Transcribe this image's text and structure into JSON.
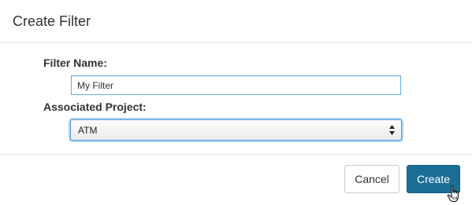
{
  "dialog": {
    "title": "Create Filter"
  },
  "form": {
    "filter_name_label": "Filter Name:",
    "filter_name_value": "My Filter",
    "project_label": "Associated Project:",
    "project_selected": "ATM"
  },
  "footer": {
    "cancel_label": "Cancel",
    "create_label": "Create"
  },
  "colors": {
    "primary_button": "#1a6e96",
    "focus_border": "#66afe9"
  },
  "icons": {
    "select_arrows": "select-updown-arrows-icon",
    "cursor": "hand-pointer-cursor-icon"
  }
}
